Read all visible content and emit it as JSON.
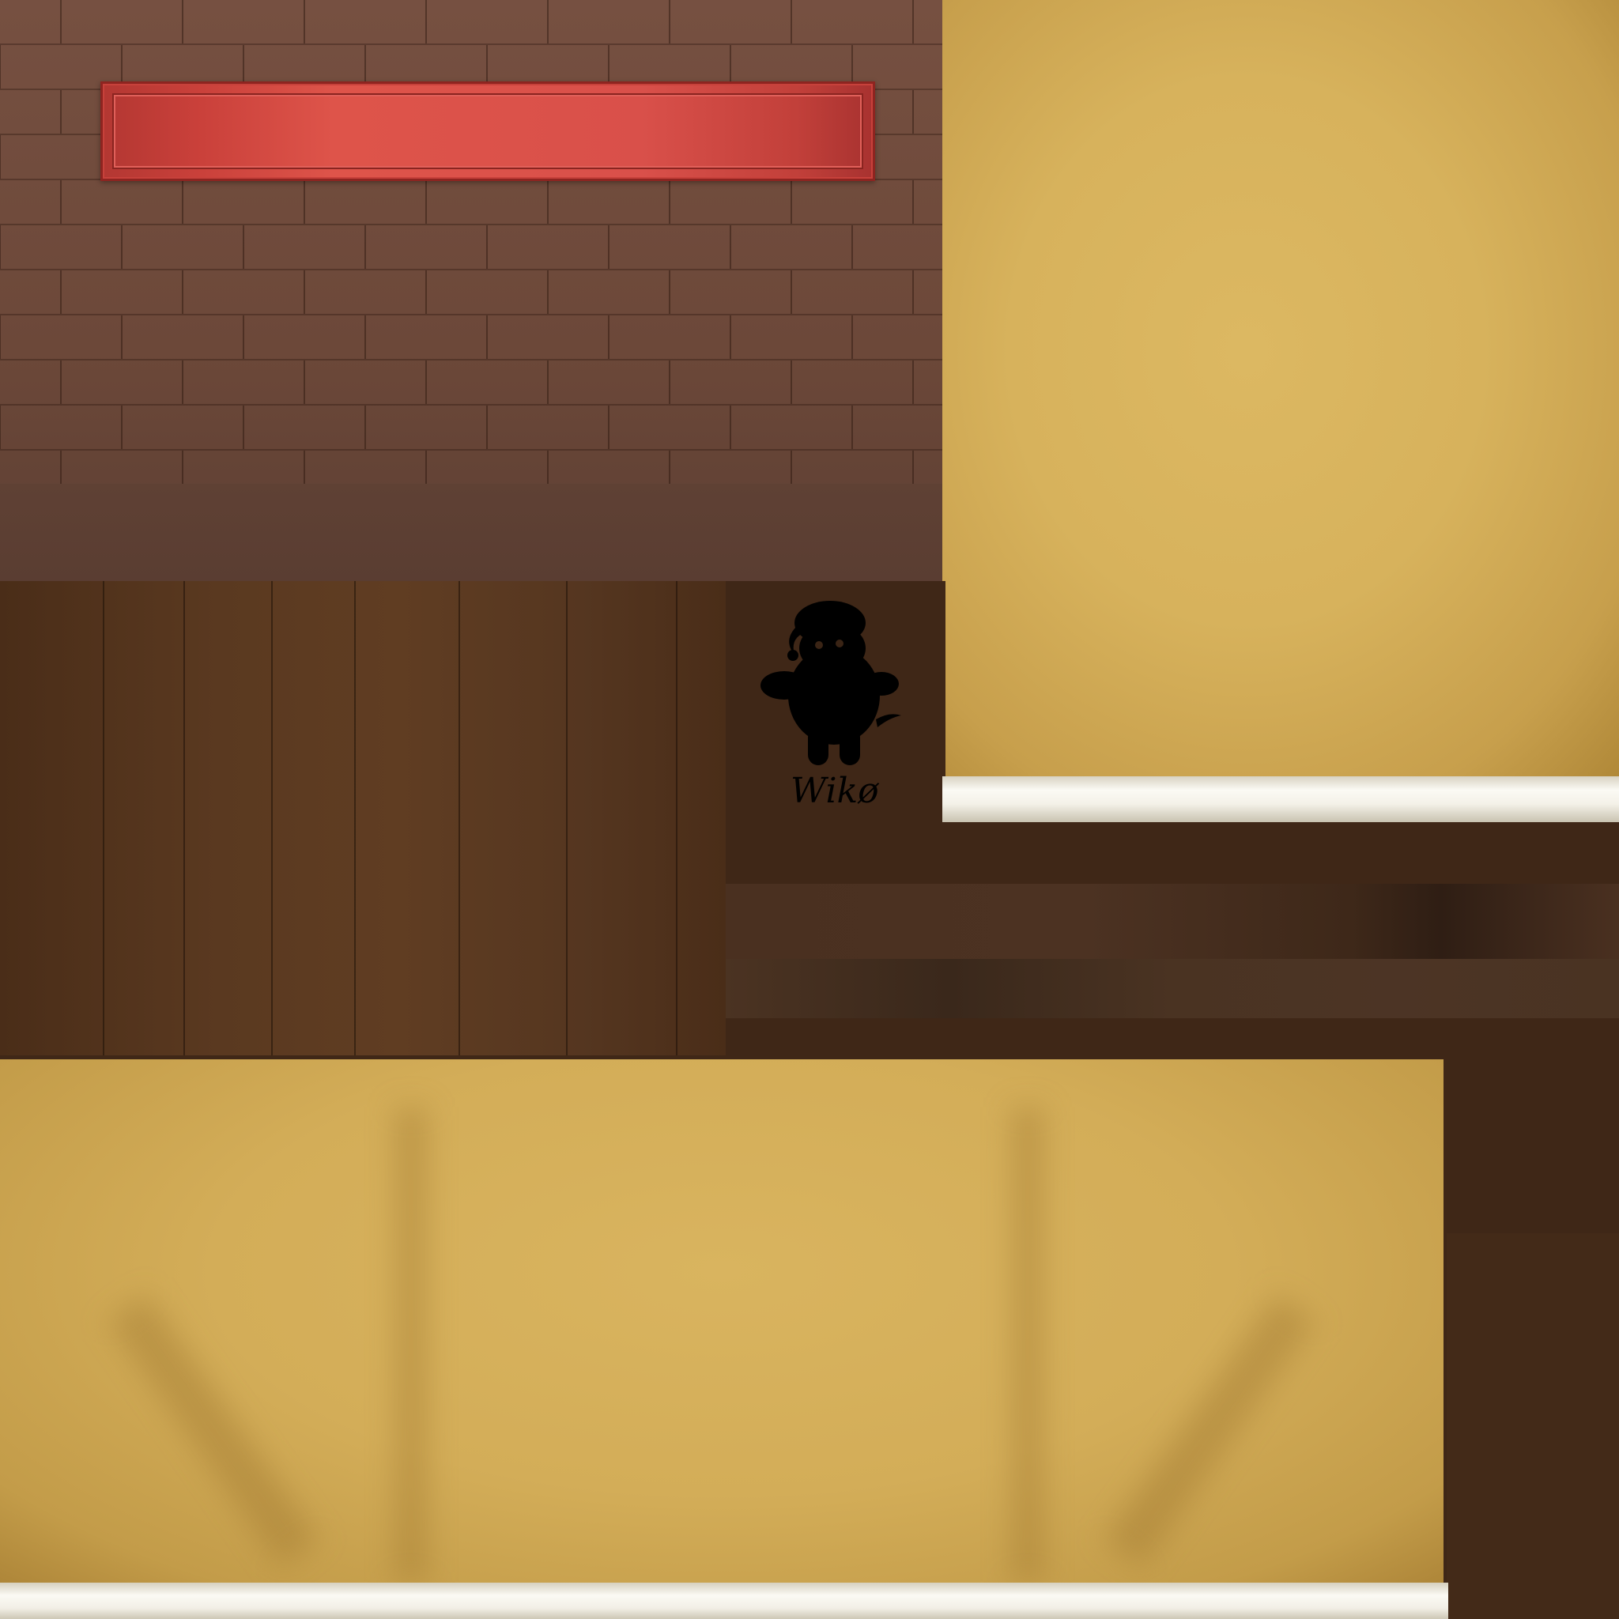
{
  "scene": {
    "watermark": {
      "text": "Wikø",
      "icon": "sleeping-figure-icon"
    },
    "sign": {
      "text": ""
    }
  },
  "colors": {
    "brick": "#6e4a3b",
    "sign_red": "#d9504a",
    "yellow_panel": "#d7b25c",
    "wood": "#5a3920",
    "shelf": "#f4f1e8",
    "background_dark": "#3f2717"
  }
}
